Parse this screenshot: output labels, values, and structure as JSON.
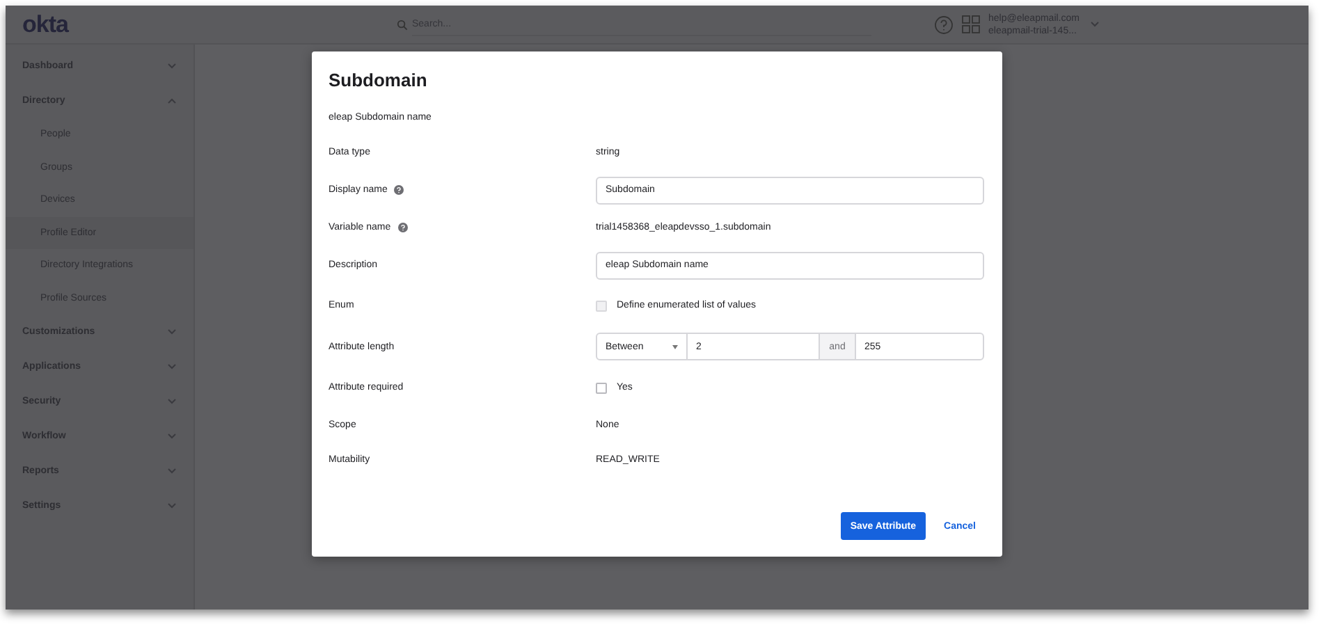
{
  "header": {
    "logo": "okta",
    "search": {
      "placeholder": "Search..."
    },
    "user": {
      "email": "help@eleapmail.com",
      "org": "eleapmail-trial-145..."
    }
  },
  "sidebar": {
    "items": [
      {
        "label": "Dashboard",
        "expanded": false
      },
      {
        "label": "Directory",
        "expanded": true,
        "children": [
          {
            "label": "People",
            "selected": false
          },
          {
            "label": "Groups",
            "selected": false
          },
          {
            "label": "Devices",
            "selected": false
          },
          {
            "label": "Profile Editor",
            "selected": true
          },
          {
            "label": "Directory Integrations",
            "selected": false
          },
          {
            "label": "Profile Sources",
            "selected": false
          }
        ]
      },
      {
        "label": "Customizations",
        "expanded": false
      },
      {
        "label": "Applications",
        "expanded": false
      },
      {
        "label": "Security",
        "expanded": false
      },
      {
        "label": "Workflow",
        "expanded": false
      },
      {
        "label": "Reports",
        "expanded": false
      },
      {
        "label": "Settings",
        "expanded": false
      }
    ]
  },
  "modal": {
    "title": "Subdomain",
    "description": "eleap Subdomain name",
    "fields": [
      {
        "kind": "text",
        "label": "Data type",
        "value": "string",
        "help": false
      },
      {
        "kind": "input",
        "label": "Display name",
        "value": "Subdomain",
        "help": true
      },
      {
        "kind": "text",
        "label": "Variable name",
        "value": "trial1458368_eleapdevsso_1.subdomain",
        "help": true
      },
      {
        "kind": "input",
        "label": "Description",
        "value": "eleap Subdomain name",
        "help": false
      },
      {
        "kind": "checkbox",
        "label": "Enum",
        "option": "Define enumerated list of values",
        "checked": false,
        "disabled": true
      },
      {
        "kind": "range",
        "label": "Attribute length",
        "mode": "Between",
        "min": "2",
        "joiner": "and",
        "max": "255"
      },
      {
        "kind": "checkbox",
        "label": "Attribute required",
        "option": "Yes",
        "checked": false,
        "disabled": false
      },
      {
        "kind": "text",
        "label": "Scope",
        "value": "None",
        "help": false
      },
      {
        "kind": "text",
        "label": "Mutability",
        "value": "READ_WRITE",
        "help": false
      }
    ],
    "buttons": [
      {
        "kind": "primary",
        "label": "Save Attribute"
      },
      {
        "kind": "link",
        "label": "Cancel"
      }
    ]
  }
}
